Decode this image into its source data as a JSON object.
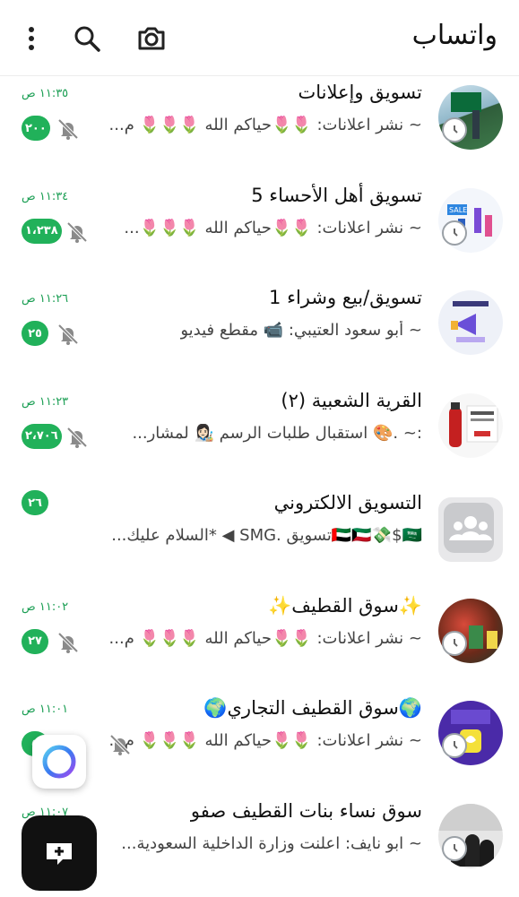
{
  "header": {
    "title": "واتساب",
    "icons": [
      "more-icon",
      "search-icon",
      "camera-icon"
    ]
  },
  "chats": [
    {
      "name": "تسويق وإعلانات",
      "preview": "~ نشر اعلانات: 🌷🌷حياكم الله 🌷🌷🌷 م...",
      "time": "١١:٣٥ ص",
      "unread": "٢٠٠",
      "muted": true,
      "avatar": "flag-image"
    },
    {
      "name": "تسويق أهل الأحساء 5",
      "preview": "~ نشر اعلانات: 🌷🌷حياكم الله 🌷🌷🌷...",
      "time": "١١:٣٤ ص",
      "unread": "١،٢٣٨",
      "muted": true,
      "avatar": "sale-image"
    },
    {
      "name": "تسويق/بيع وشراء 1",
      "preview": "~ أبو سعود العتيبي: 📹 مقطع فيديو",
      "time": "١١:٢٦ ص",
      "unread": "٢٥",
      "muted": true,
      "avatar": "megaphone-image"
    },
    {
      "name": "القرية الشعبية (٢)",
      "preview": ":~ .🎨 استقبال طلبات الرسم 👩🏻‍🎨 لمشار...",
      "time": "١١:٢٣ ص",
      "unread": "٢،٧٠٦",
      "muted": true,
      "avatar": "extinguisher-image"
    },
    {
      "name": "التسويق الالكتروني",
      "preview": "🇦🇪🇰🇼💸$🇸🇦تسويق .SMG ◀ *السلام عليك...",
      "time": "",
      "unread": "٢٦",
      "muted": false,
      "avatar": "community-icon"
    },
    {
      "name": "✨سوق القطيف✨",
      "preview": "~ نشر اعلانات: 🌷🌷حياكم الله 🌷🌷🌷 م...",
      "time": "١١:٠٢ ص",
      "unread": "٢٧",
      "muted": true,
      "avatar": "market-image"
    },
    {
      "name": "🌍سوق القطيف التجاري🌍",
      "preview": "~ نشر اعلانات: 🌷🌷حياكم الله 🌷🌷🌷 م...",
      "time": "١١:٠١ ص",
      "unread": "٥",
      "muted": true,
      "avatar": "snapchat-image"
    },
    {
      "name": "سوق نساء بنات  القطيف صفو",
      "preview": "~ ابو نايف: اعلنت وزارة الداخلية السعودية...",
      "time": "١١:٠٧ ص",
      "unread": "",
      "muted": false,
      "avatar": "women-image"
    }
  ],
  "fab": {
    "icon": "new-chat-icon"
  },
  "overlay": {
    "icon": "assistant-ring-icon"
  },
  "colors": {
    "accent": "#21b15a",
    "time": "#1a9e53"
  }
}
